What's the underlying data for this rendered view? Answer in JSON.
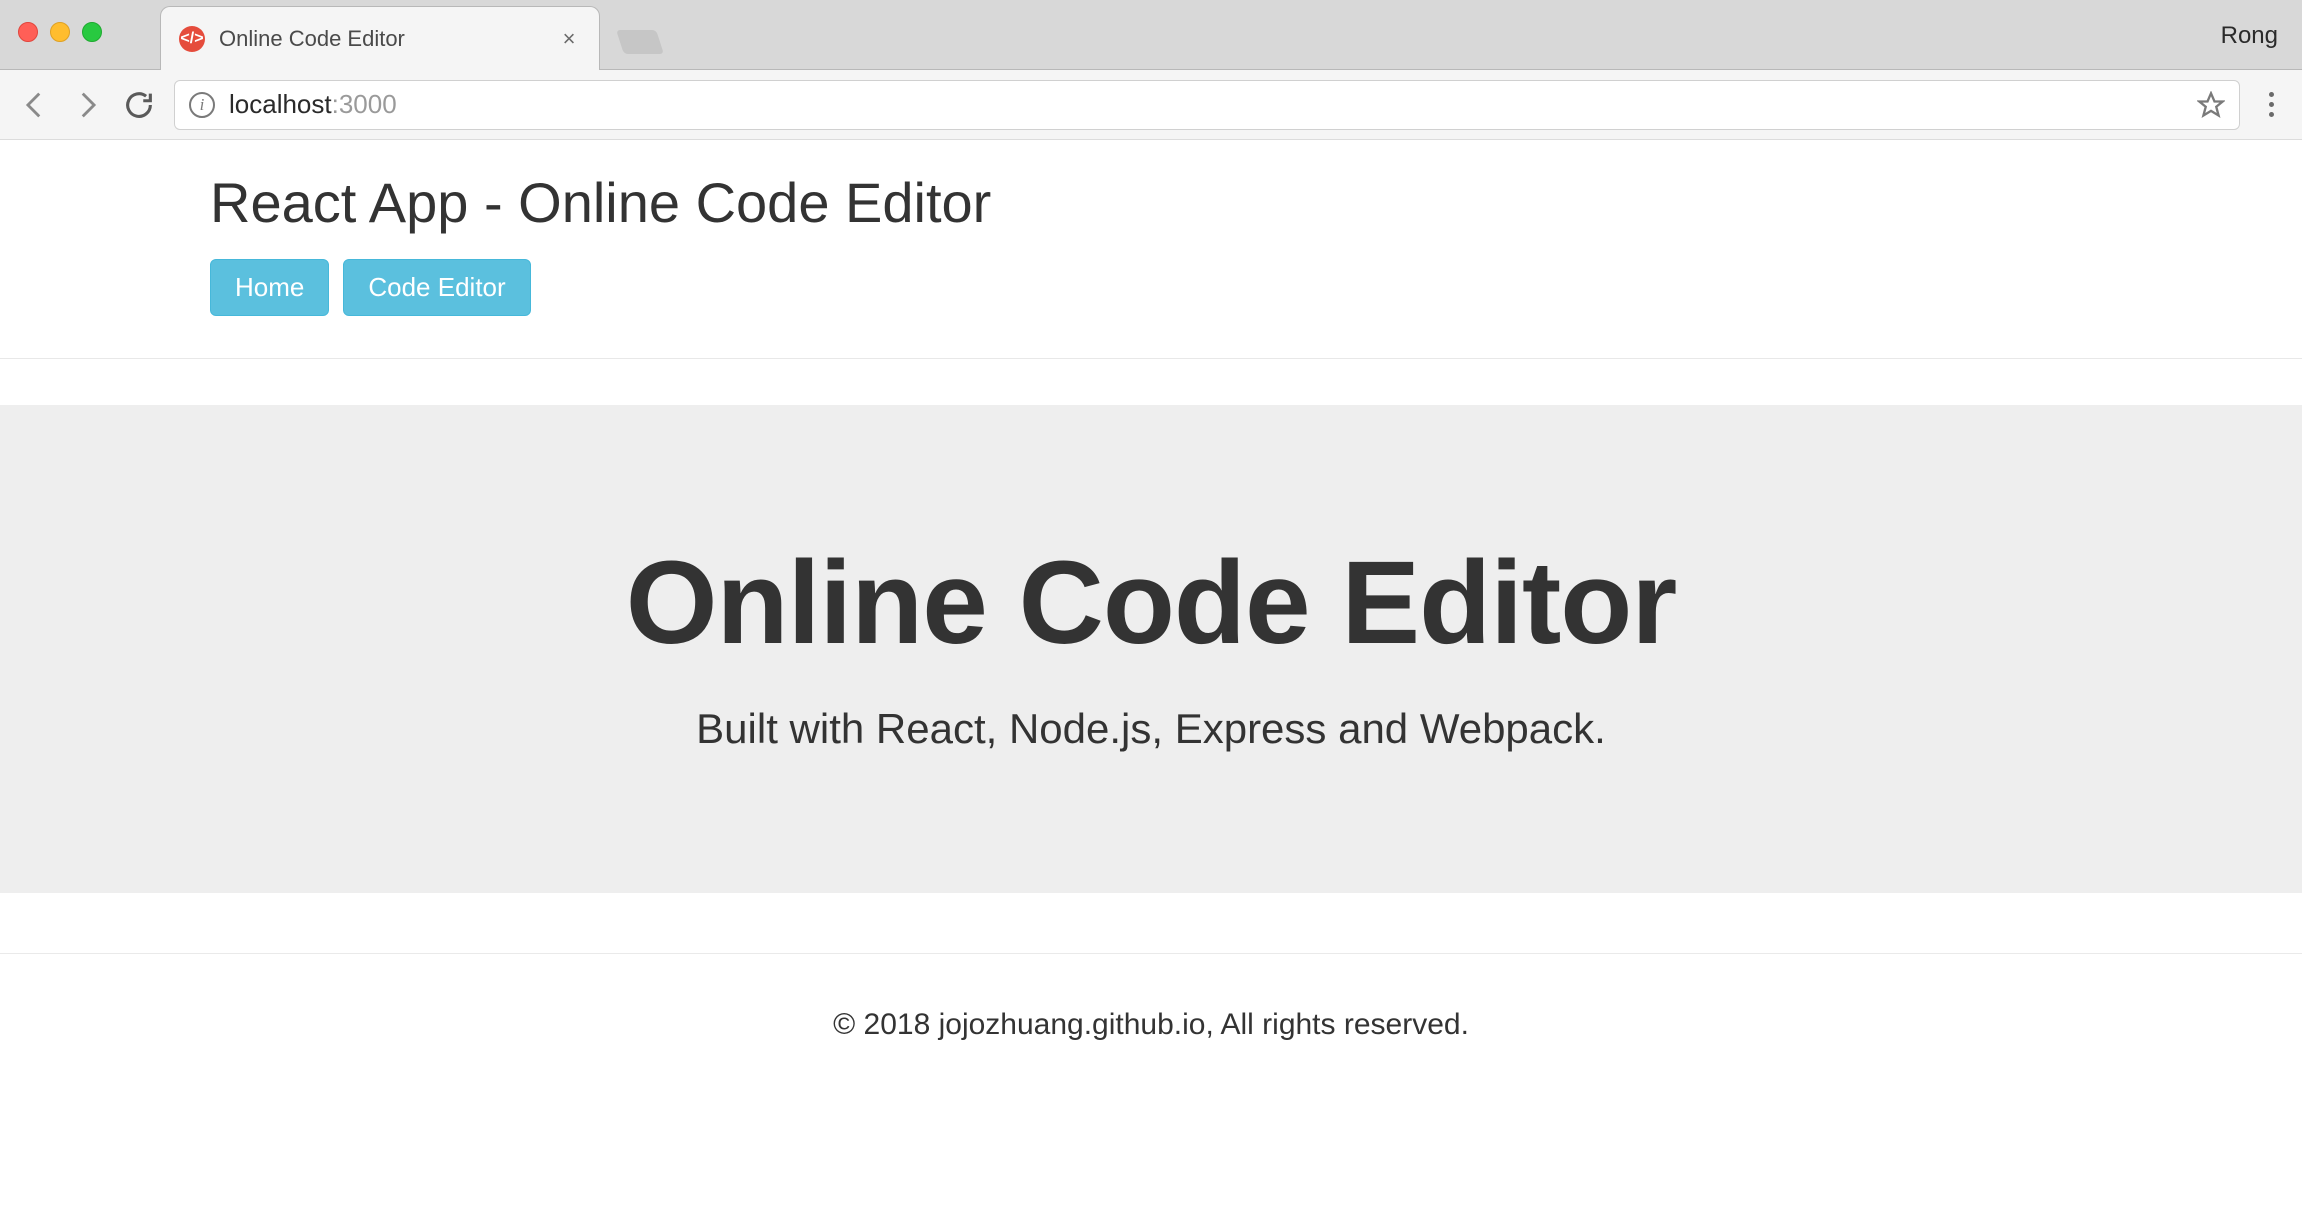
{
  "browser": {
    "tab_title": "Online Code Editor",
    "profile_name": "Rong",
    "url_host": "localhost",
    "url_port": ":3000"
  },
  "header": {
    "title": "React App - Online Code Editor",
    "nav": [
      {
        "label": "Home"
      },
      {
        "label": "Code Editor"
      }
    ]
  },
  "hero": {
    "title": "Online Code Editor",
    "subtitle": "Built with React, Node.js, Express and Webpack."
  },
  "footer": {
    "text": "© 2018 jojozhuang.github.io, All rights reserved."
  }
}
